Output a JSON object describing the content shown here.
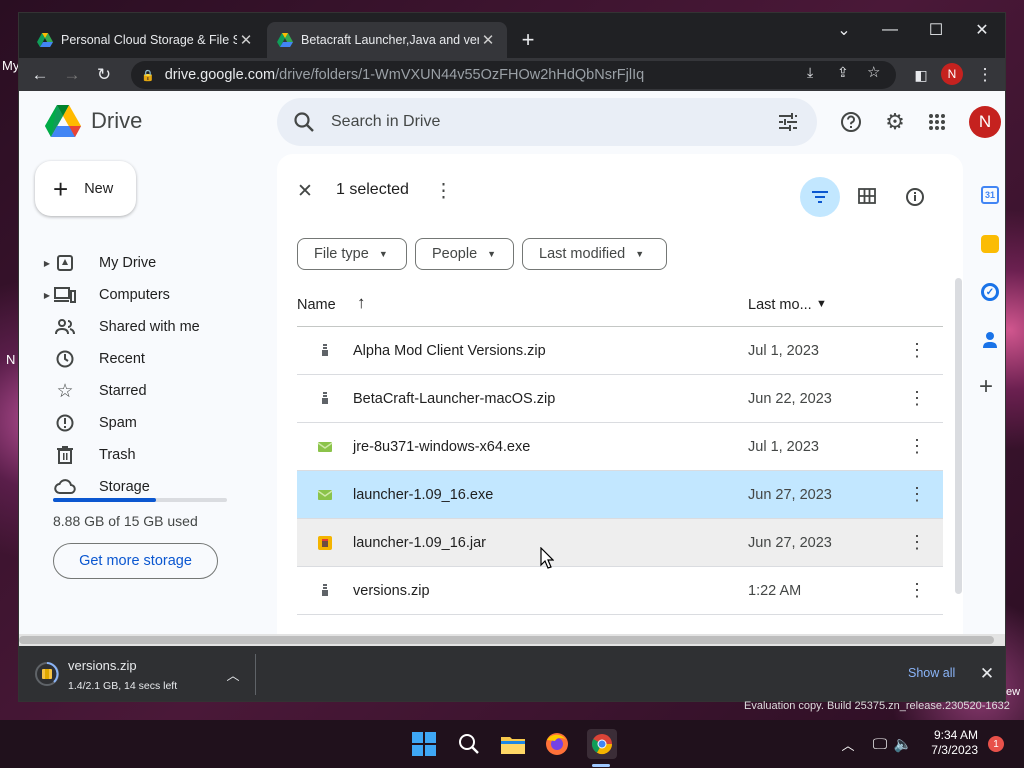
{
  "browser": {
    "tabs": [
      {
        "title": "Personal Cloud Storage & File Sh"
      },
      {
        "title": "Betacraft Launcher,Java and versi"
      }
    ],
    "url_host": "drive.google.com",
    "url_path": "/drive/folders/1-WmVXUN44v55OzFHOw2hHdQbNsrFjlIq",
    "profile_initial": "N"
  },
  "drive": {
    "logo_text": "Drive",
    "new_label": "New",
    "search_placeholder": "Search in Drive",
    "account_initial": "N",
    "nav": [
      {
        "label": "My Drive",
        "icon": "my-drive-icon"
      },
      {
        "label": "Computers",
        "icon": "computers-icon"
      },
      {
        "label": "Shared with me",
        "icon": "shared-icon"
      },
      {
        "label": "Recent",
        "icon": "clock-icon"
      },
      {
        "label": "Starred",
        "icon": "star-icon"
      },
      {
        "label": "Spam",
        "icon": "spam-icon"
      },
      {
        "label": "Trash",
        "icon": "trash-icon"
      },
      {
        "label": "Storage",
        "icon": "cloud-icon"
      }
    ],
    "storage": {
      "used_fraction": 0.59,
      "text": "8.88 GB of 15 GB used",
      "button": "Get more storage"
    },
    "selection_text": "1 selected",
    "filters": [
      "File type",
      "People",
      "Last modified"
    ],
    "columns": {
      "name": "Name",
      "modified": "Last mo..."
    },
    "files": [
      {
        "name": "Alpha Mod Client Versions.zip",
        "modified": "Jul 1, 2023",
        "type": "zip",
        "state": "normal"
      },
      {
        "name": "BetaCraft-Launcher-macOS.zip",
        "modified": "Jun 22, 2023",
        "type": "zip",
        "state": "normal"
      },
      {
        "name": "jre-8u371-windows-x64.exe",
        "modified": "Jul 1, 2023",
        "type": "exe",
        "state": "normal"
      },
      {
        "name": "launcher-1.09_16.exe",
        "modified": "Jun 27, 2023",
        "type": "exe",
        "state": "selected"
      },
      {
        "name": "launcher-1.09_16.jar",
        "modified": "Jun 27, 2023",
        "type": "jar",
        "state": "hover"
      },
      {
        "name": "versions.zip",
        "modified": "1:22 AM",
        "type": "zip",
        "state": "normal"
      }
    ]
  },
  "download": {
    "filename": "versions.zip",
    "status": "1.4/2.1 GB, 14 secs left",
    "show_all": "Show all"
  },
  "desktop": {
    "side_text_1": "My",
    "side_text_2": "N",
    "side_text_3": "ew",
    "eval_text": "Evaluation copy. Build 25375.zn_release.230520-1632"
  },
  "taskbar": {
    "time": "9:34 AM",
    "date": "7/3/2023",
    "notification_count": "1"
  },
  "colors": {
    "accent": "#0b57d0",
    "selected_row": "#c2e7ff",
    "hover_row": "#eeeeee",
    "avatar": "#c5221f"
  }
}
